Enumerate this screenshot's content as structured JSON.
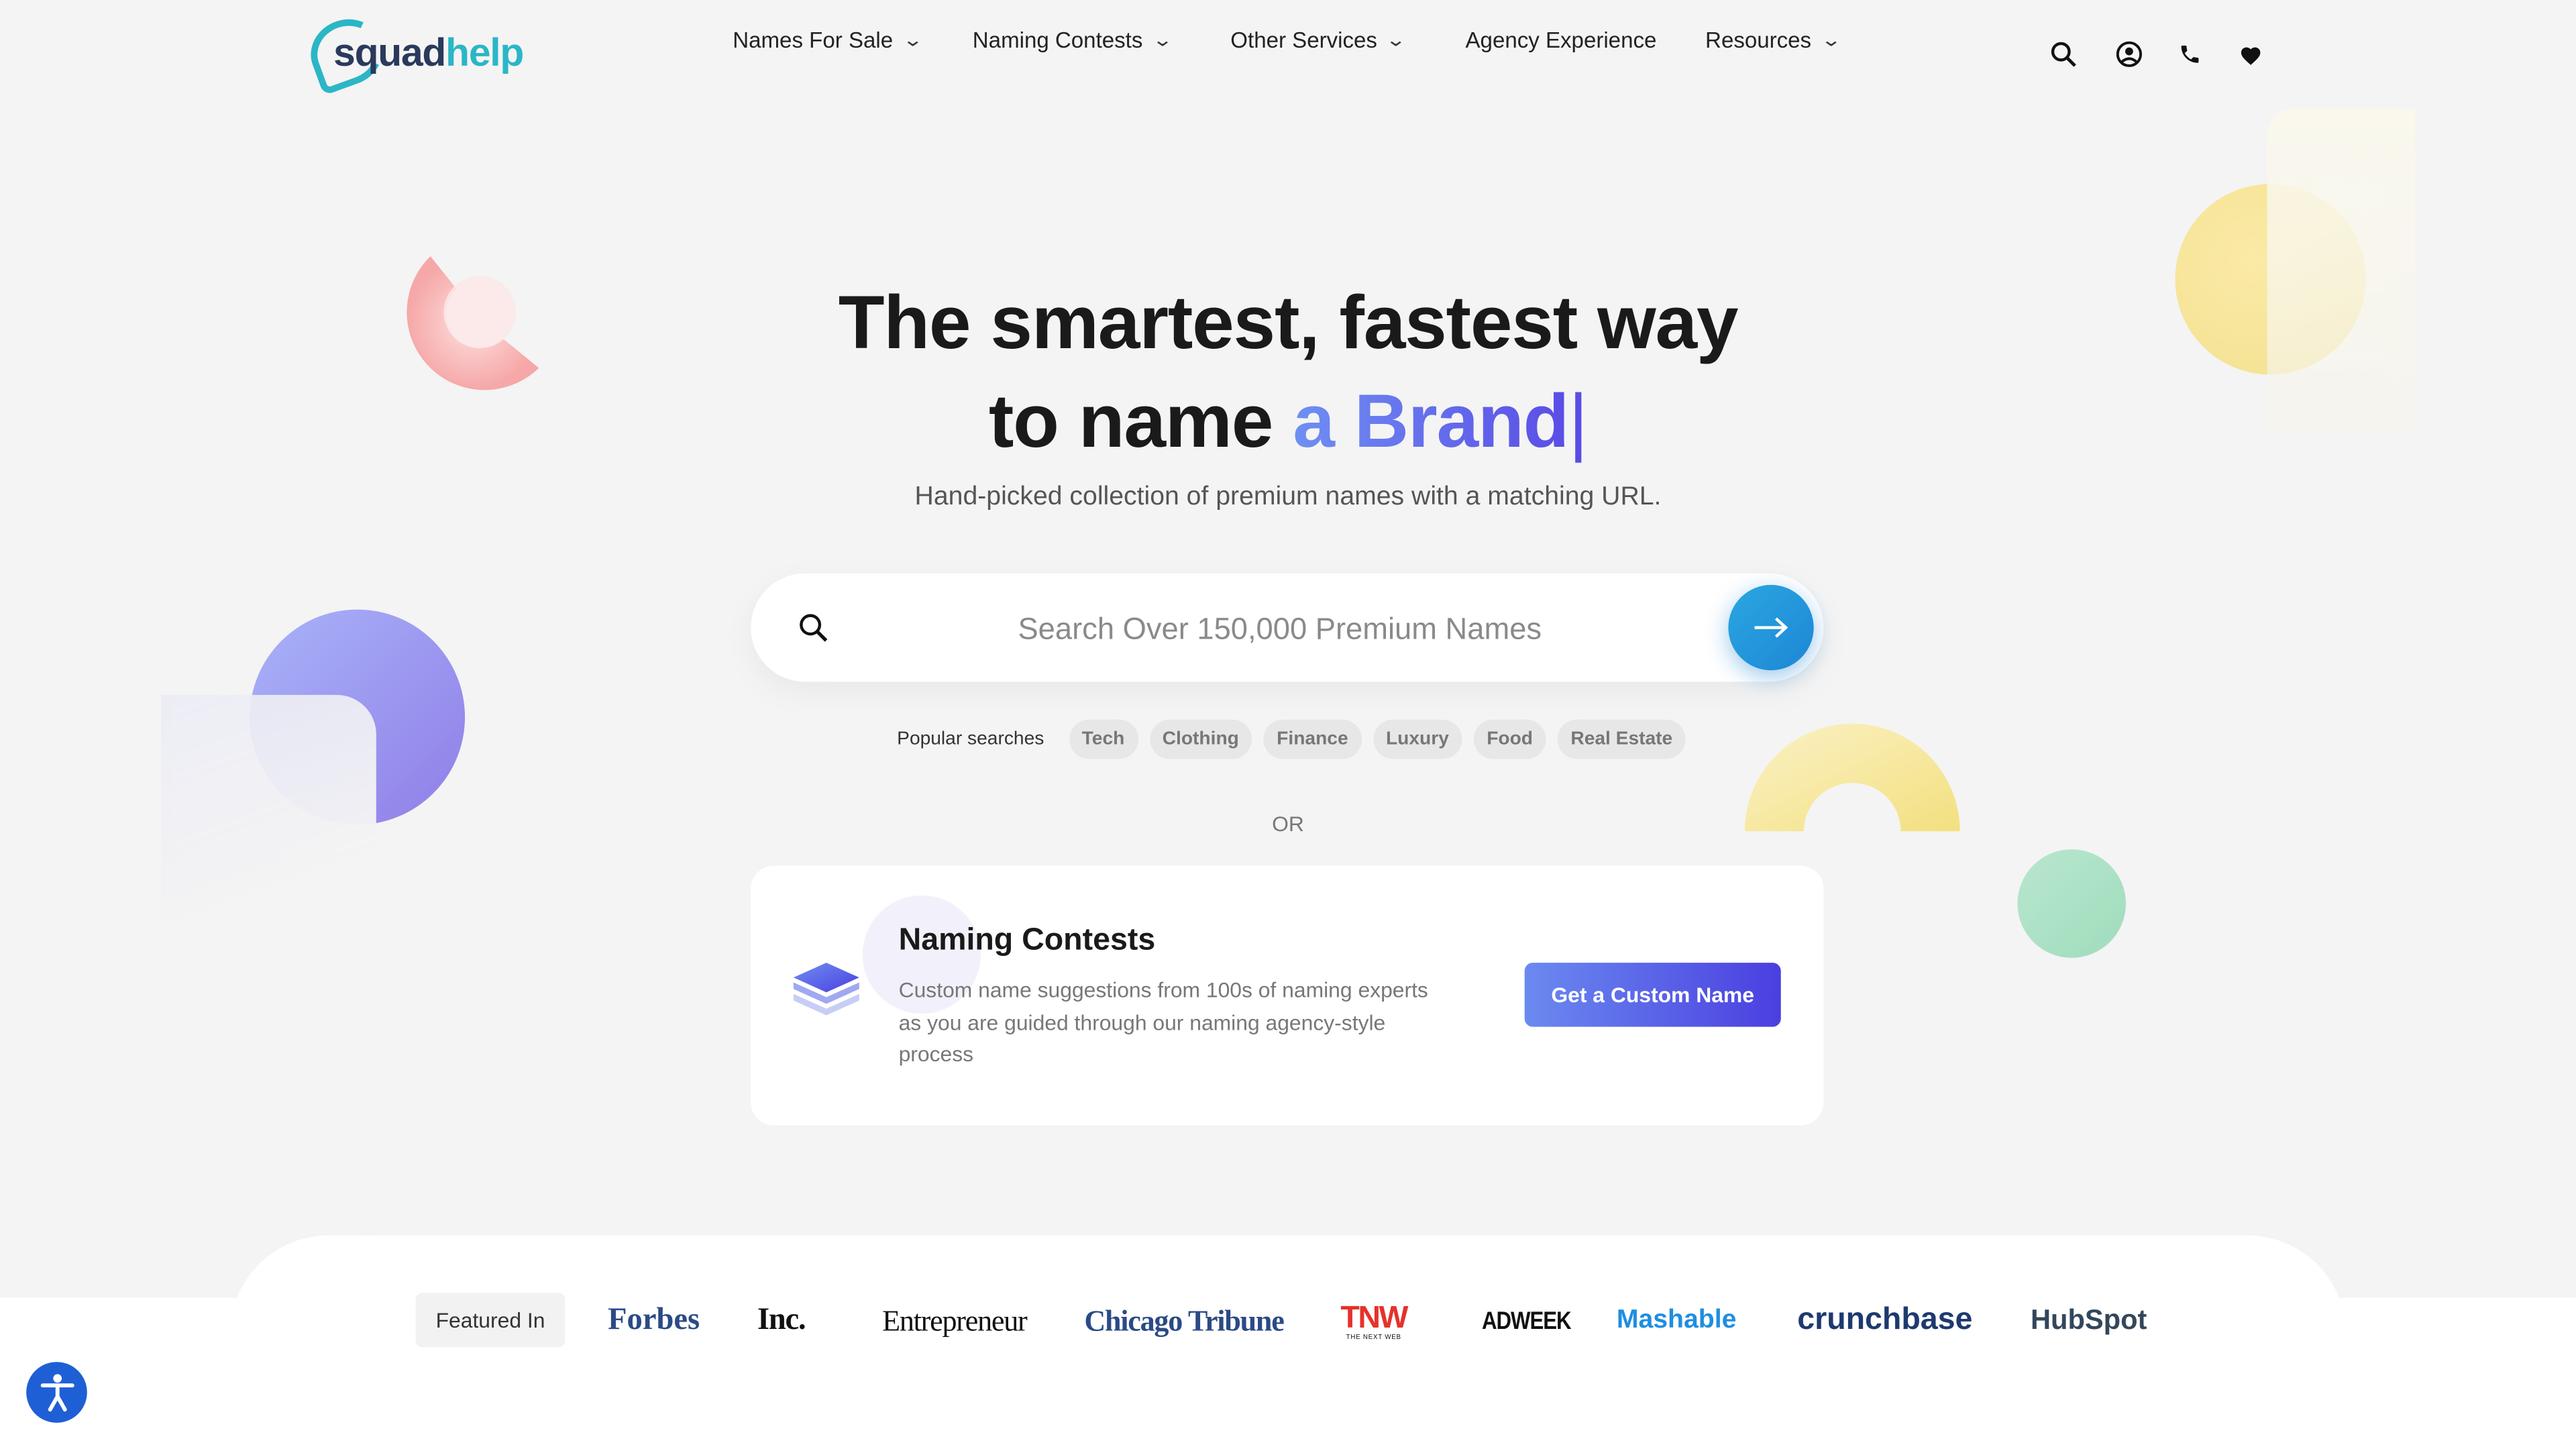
{
  "header": {
    "logo": {
      "part1": "squad",
      "part2": "help"
    },
    "nav": [
      {
        "label": "Names For Sale",
        "has_dropdown": true
      },
      {
        "label": "Naming Contests",
        "has_dropdown": true
      },
      {
        "label": "Other Services",
        "has_dropdown": true
      },
      {
        "label": "Agency Experience",
        "has_dropdown": false
      },
      {
        "label": "Resources",
        "has_dropdown": true
      }
    ],
    "icons": [
      "search-icon",
      "user-icon",
      "phone-icon",
      "heart-icon"
    ]
  },
  "hero": {
    "title_line1": "The smartest, fastest way",
    "title_line2_prefix": "to name ",
    "title_line2_accent": "a Brand",
    "caret": "|",
    "subtitle": "Hand-picked collection of premium names with a matching URL."
  },
  "search": {
    "placeholder": "Search Over 150,000 Premium Names",
    "value": ""
  },
  "popular": {
    "label": "Popular searches",
    "chips": [
      "Tech",
      "Clothing",
      "Finance",
      "Luxury",
      "Food",
      "Real Estate"
    ]
  },
  "or_text": "OR",
  "contest_card": {
    "title": "Naming Contests",
    "description": "Custom name suggestions from 100s of naming experts as you are guided through our naming agency-style process",
    "button": "Get a Custom Name"
  },
  "featured": {
    "label": "Featured In",
    "brands": [
      "Forbes",
      "Inc.",
      "Entrepreneur",
      "Chicago Tribune",
      "TNW",
      "ADWEEK",
      "Mashable",
      "crunchbase",
      "HubSpot"
    ],
    "tnw_sub": "THE NEXT WEB"
  },
  "colors": {
    "accent_blue": "#5a4de6",
    "logo_teal": "#2bb6c6",
    "logo_navy": "#2a3a5c",
    "search_button": "#1e86d6",
    "accessibility_button": "#1f5fd6"
  }
}
